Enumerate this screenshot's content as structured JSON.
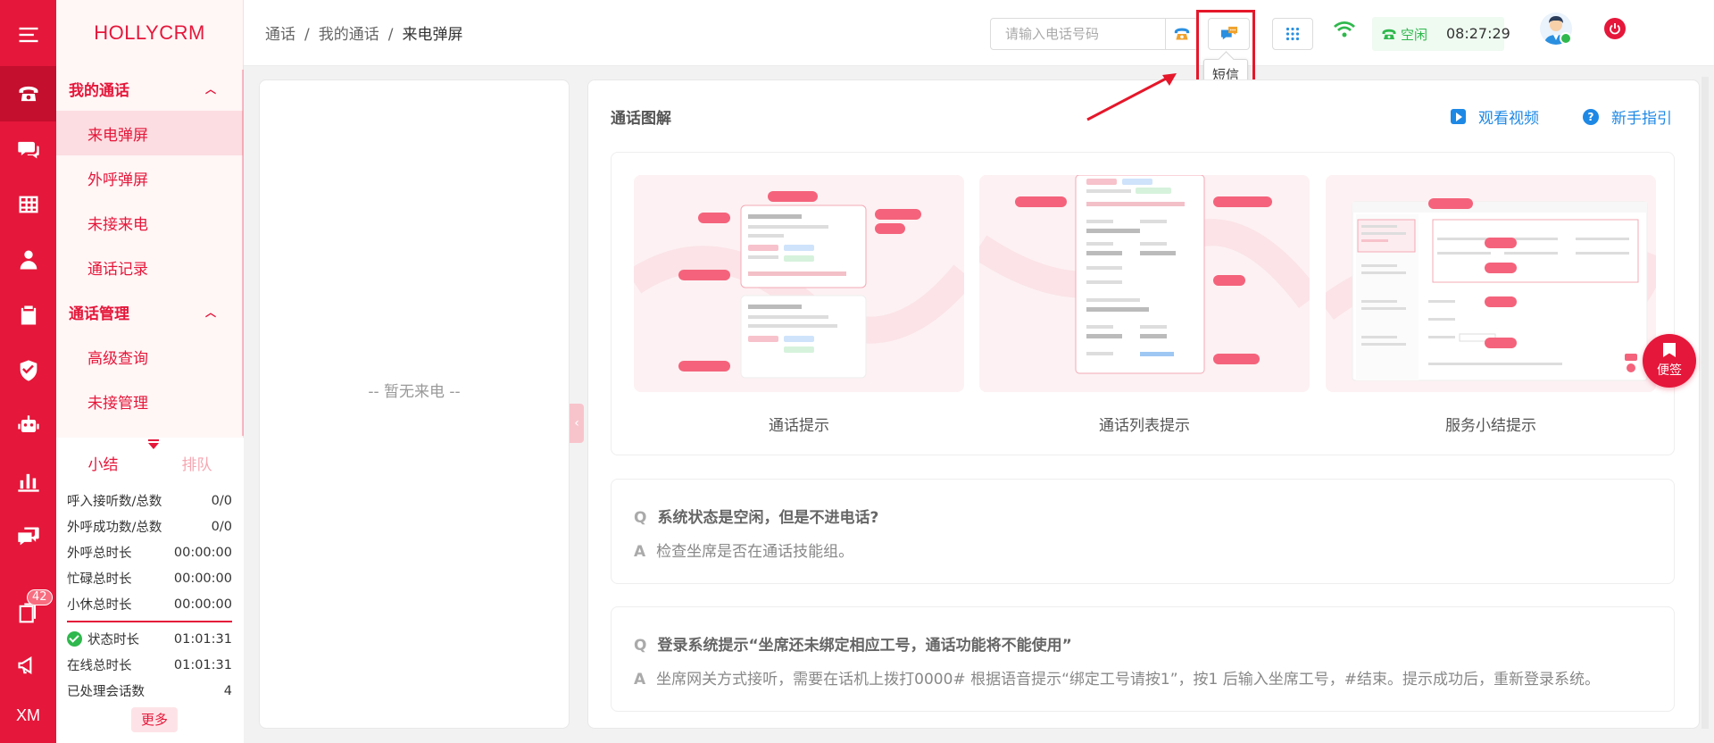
{
  "app": {
    "brand": "HOLLYCRM"
  },
  "rail": {
    "items": [
      {
        "icon": "menu-icon"
      },
      {
        "icon": "phone-icon",
        "active": true
      },
      {
        "icon": "chat-icon"
      },
      {
        "icon": "table-icon"
      },
      {
        "icon": "user-icon"
      },
      {
        "icon": "clipboard-icon"
      },
      {
        "icon": "shield-icon"
      },
      {
        "icon": "robot-icon"
      },
      {
        "icon": "bar-chart-icon"
      },
      {
        "icon": "message-icon"
      },
      {
        "icon": "tasks-icon",
        "badge": "42"
      },
      {
        "icon": "megaphone-icon"
      },
      {
        "icon": "xm-icon",
        "label": "XM"
      }
    ]
  },
  "nav": {
    "groups": [
      {
        "label": "我的通话",
        "items": [
          "来电弹屏",
          "外呼弹屏",
          "未接来电",
          "通话记录"
        ]
      },
      {
        "label": "通话管理",
        "items": [
          "高级查询",
          "未接管理"
        ]
      }
    ],
    "active_item": "来电弹屏"
  },
  "summary": {
    "tabs": [
      "小结",
      "排队"
    ],
    "rows": [
      {
        "label": "呼入接听数/总数",
        "value": "0/0"
      },
      {
        "label": "外呼成功数/总数",
        "value": "0/0"
      },
      {
        "label": "外呼总时长",
        "value": "00:00:00"
      },
      {
        "label": "忙碌总时长",
        "value": "00:00:00"
      },
      {
        "label": "小休总时长",
        "value": "00:00:00"
      }
    ],
    "rows2": [
      {
        "label": "状态时长",
        "value": "01:01:31"
      },
      {
        "label": "在线总时长",
        "value": "01:01:31"
      },
      {
        "label": "已处理会话数",
        "value": "4"
      }
    ],
    "more": "更多"
  },
  "topbar": {
    "breadcrumb": [
      "通话",
      "我的通话",
      "来电弹屏"
    ],
    "phone_placeholder": "请输入电话号码",
    "sms_tooltip": "短信",
    "status_text": "空闲",
    "status_time": "08:27:29"
  },
  "left_panel": {
    "empty_text": "-- 暂无来电 --"
  },
  "main": {
    "title": "通话图解",
    "watch_video": "观看视频",
    "guide": "新手指引",
    "illustrations": [
      {
        "caption": "通话提示"
      },
      {
        "caption": "通话列表提示"
      },
      {
        "caption": "服务小结提示"
      }
    ],
    "faqs": [
      {
        "q": "系统状态是空闲，但是不进电话?",
        "a": "检查坐席是否在通话技能组。"
      },
      {
        "q": "登录系统提示“坐席还未绑定相应工号，通话功能将不能使用”",
        "a": "坐席网关方式接听，需要在话机上拨打0000# 根据语音提示“绑定工号请按1”，按1 后输入坐席工号，#结束。提示成功后，重新登录系统。"
      }
    ],
    "q_key": "Q",
    "a_key": "A"
  },
  "note_button": "便签",
  "colors": {
    "brand": "#e5173a",
    "link": "#1e88e5",
    "status_green": "#2fb84d"
  }
}
